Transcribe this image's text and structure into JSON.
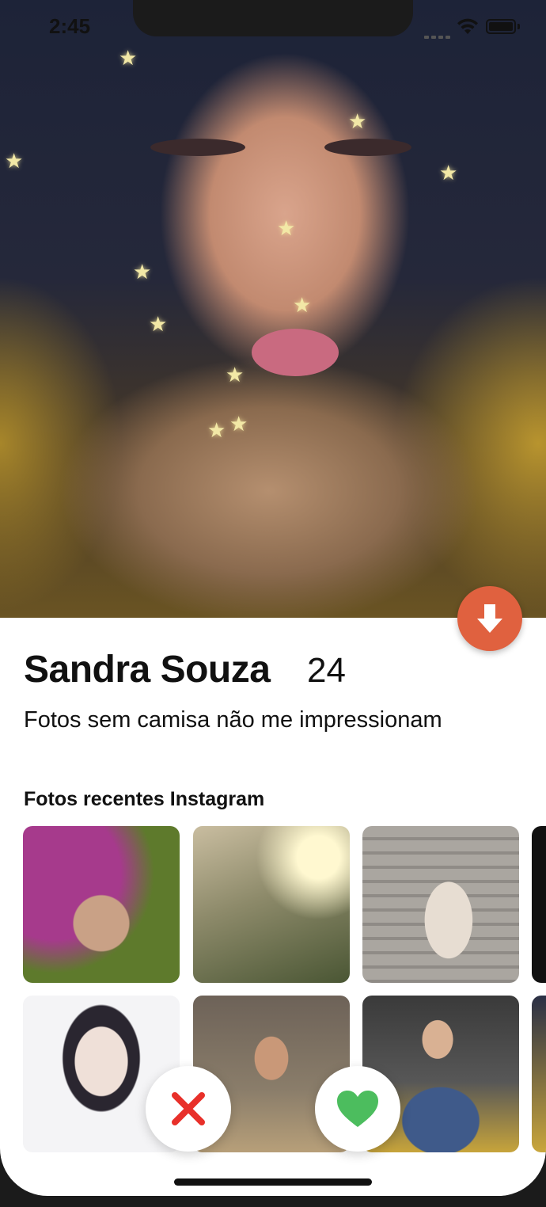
{
  "status_bar": {
    "time": "2:45",
    "icons": [
      "cellular-signal-icon",
      "wifi-icon",
      "battery-icon"
    ]
  },
  "profile": {
    "name": "Sandra Souza",
    "age": "24",
    "bio": "Fotos sem camisa não me impressionam"
  },
  "instagram": {
    "title": "Fotos recentes Instagram",
    "photos": [
      {
        "description_icon": "instagram-photo"
      },
      {
        "description_icon": "instagram-photo"
      },
      {
        "description_icon": "instagram-photo"
      },
      {
        "description_icon": "instagram-photo"
      },
      {
        "description_icon": "instagram-photo"
      },
      {
        "description_icon": "instagram-photo"
      },
      {
        "description_icon": "instagram-photo"
      },
      {
        "description_icon": "instagram-photo"
      }
    ]
  },
  "actions": {
    "collapse_icon": "arrow-down-icon",
    "dislike_icon": "close-x-icon",
    "like_icon": "heart-icon"
  },
  "colors": {
    "accent_orange": "#e0613f",
    "dislike_red": "#e8302a",
    "like_green": "#4cbd5e"
  }
}
